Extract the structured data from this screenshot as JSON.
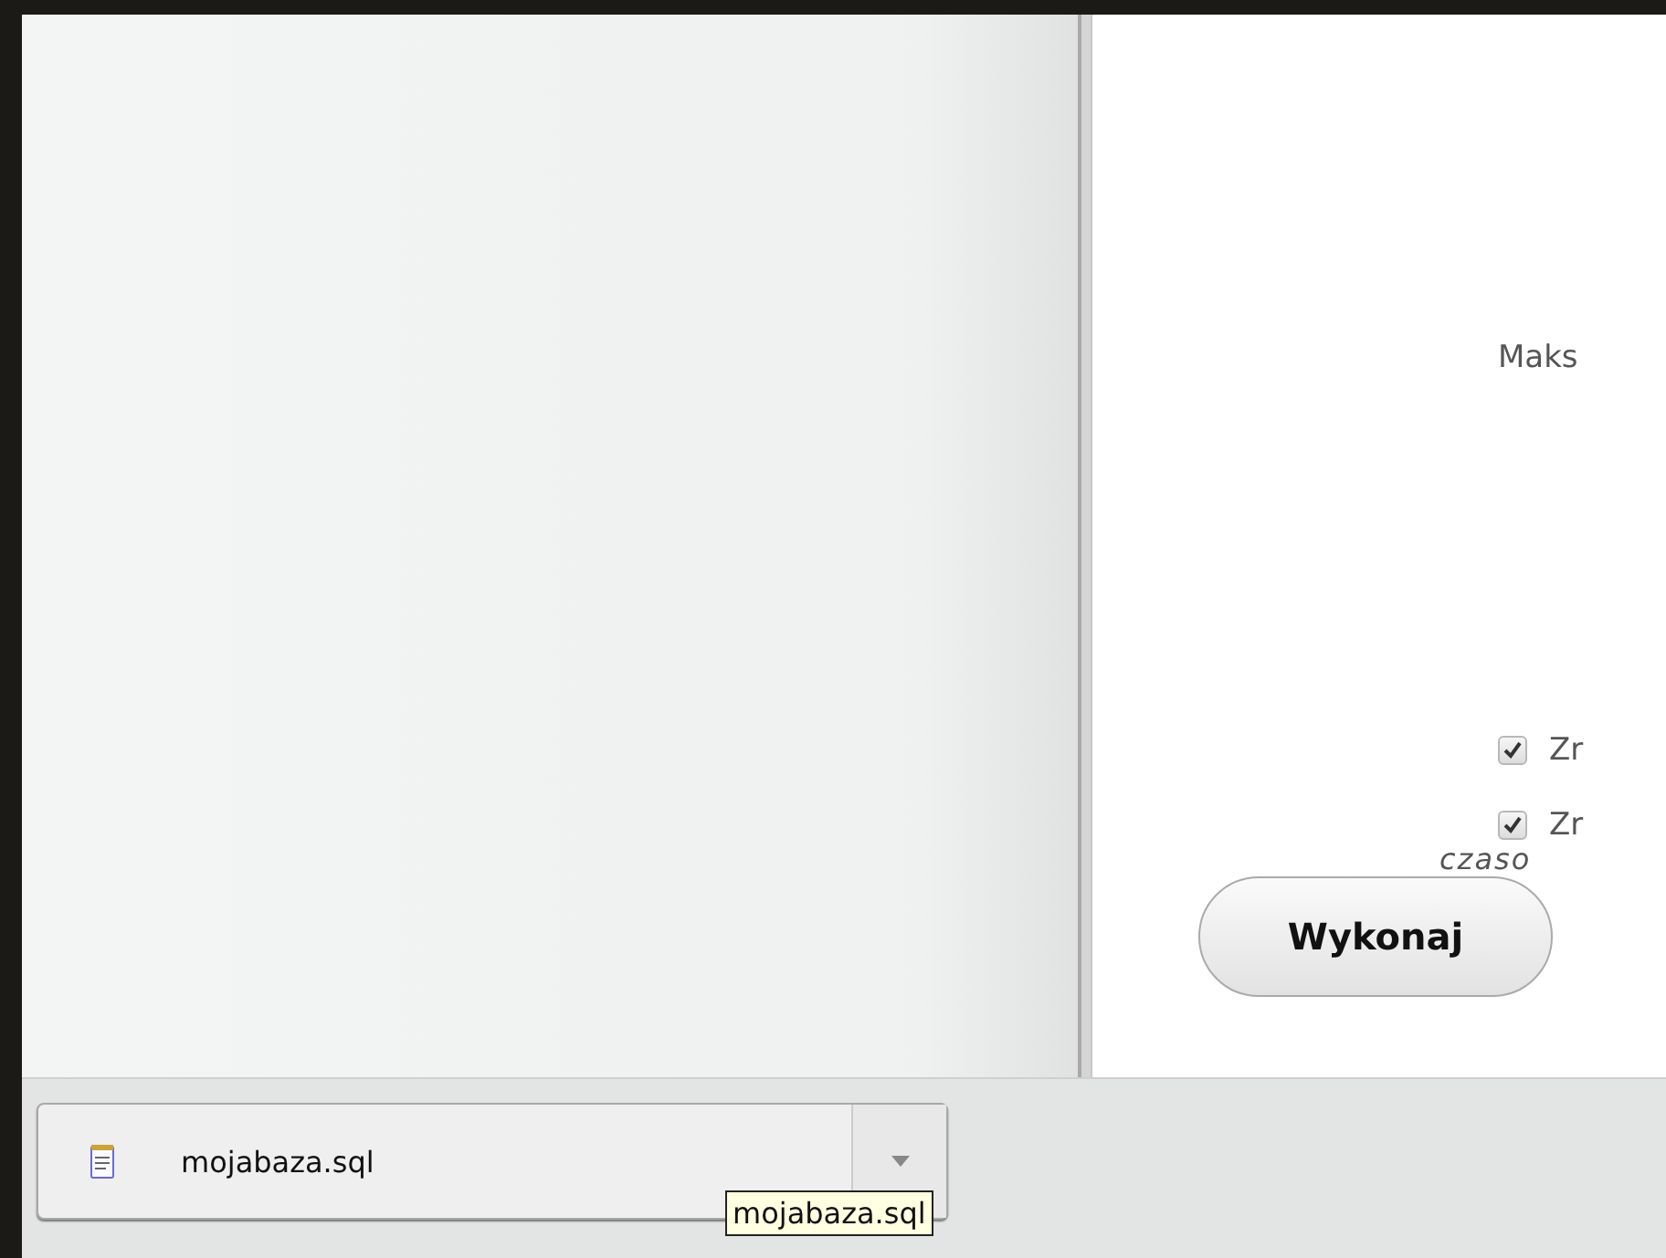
{
  "form": {
    "label": "Maks",
    "options": [
      {
        "label": "Zr",
        "checked": true
      },
      {
        "label": "Zr",
        "checked": true
      }
    ],
    "note": "czaso",
    "submit": "Wykonaj"
  },
  "download_bar": {
    "file": "mojabaza.sql",
    "tooltip": "mojabaza.sql"
  }
}
